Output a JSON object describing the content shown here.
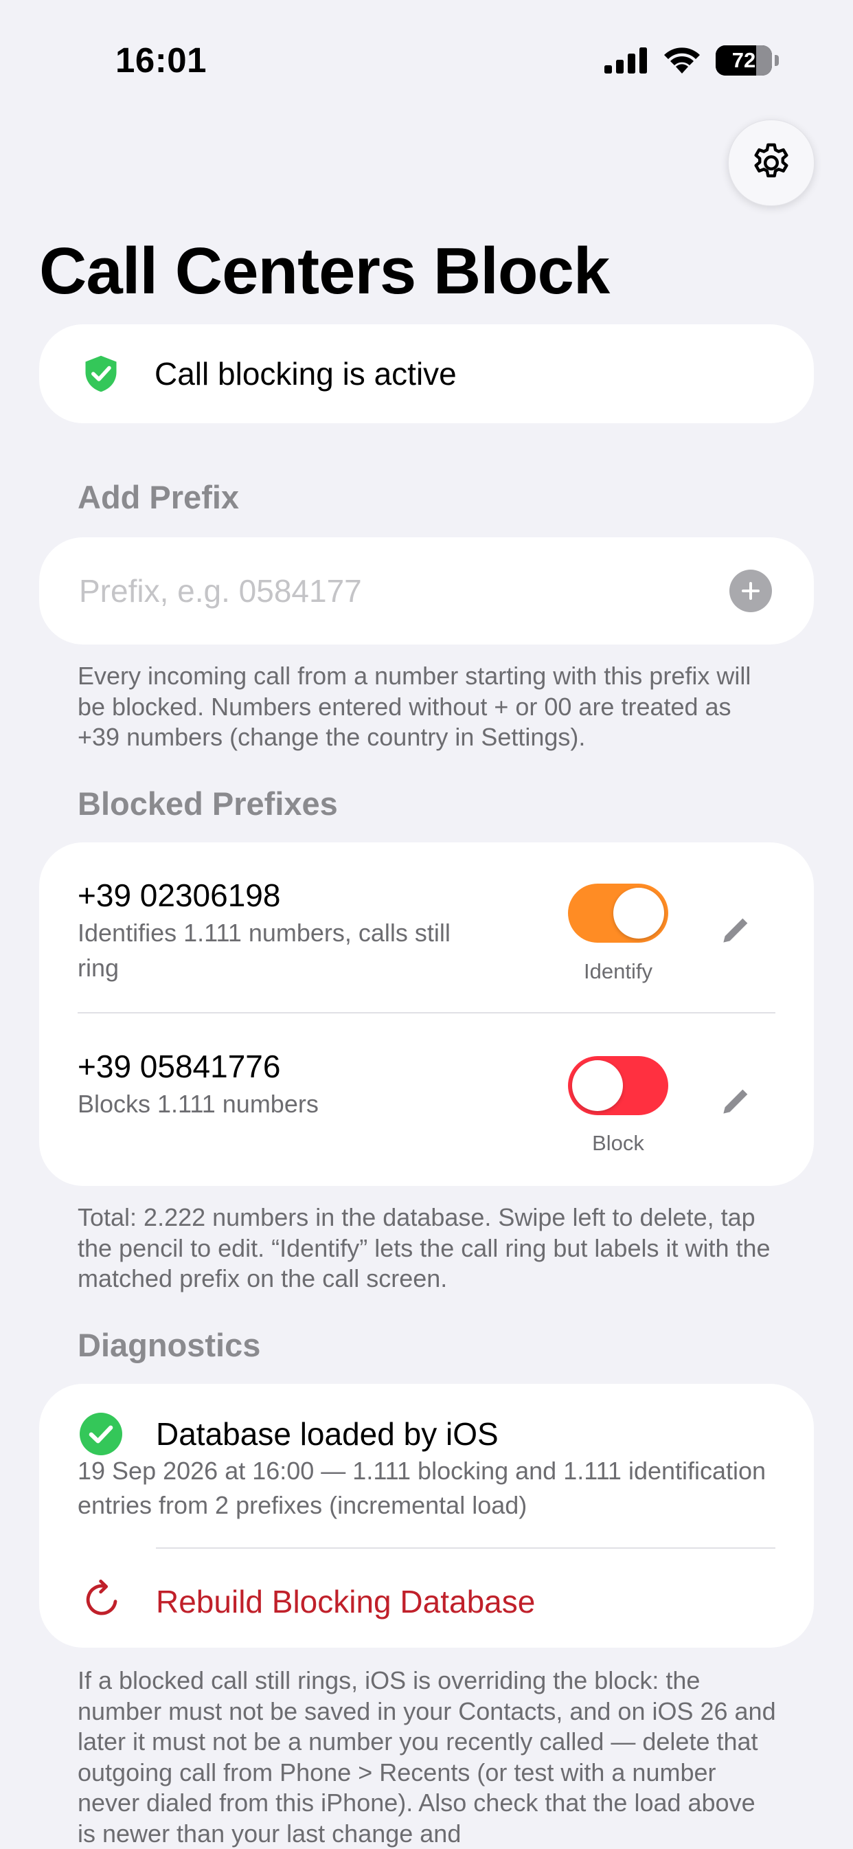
{
  "status_bar": {
    "time": "16:01",
    "battery": "72"
  },
  "header": {
    "title": "Call Centers Block",
    "settings_icon": "gear-icon"
  },
  "status": {
    "text": "Call blocking is active",
    "icon": "shield-check-icon",
    "color": "#34c759"
  },
  "add_prefix": {
    "heading": "Add Prefix",
    "placeholder": "Prefix, e.g. 0584177",
    "value": "",
    "footnote": "Every incoming call from a number starting with this prefix will be blocked. Numbers entered without + or 00 are treated as +39 numbers (change the country in Settings)."
  },
  "blocked_prefixes": {
    "heading": "Blocked Prefixes",
    "items": [
      {
        "number": "+39 02306198",
        "description": "Identifies 1.111 numbers, calls still ring",
        "mode_label": "Identify",
        "toggle_on": true,
        "toggle_color": "#ff8c24"
      },
      {
        "number": "+39 05841776",
        "description": "Blocks 1.111 numbers",
        "mode_label": "Block",
        "toggle_on": false,
        "toggle_color": "#ff3040"
      }
    ],
    "footnote": "Total: 2.222 numbers in the database. Swipe left to delete, tap the pencil to edit. “Identify” lets the call ring but labels it with the matched prefix on the call screen."
  },
  "diagnostics": {
    "heading": "Diagnostics",
    "status_title": "Database loaded by iOS",
    "status_detail": "19 Sep 2026 at 16:00 — 1.111 blocking and 1.111 identification entries from 2 prefixes (incremental load)",
    "rebuild_label": "Rebuild Blocking Database",
    "rebuild_color": "#c0202a",
    "footnote": "If a blocked call still rings, iOS is overriding the block: the number must not be saved in your Contacts, and on iOS 26 and later it must not be a number you recently called — delete that outgoing call from Phone > Recents (or test with a number never dialed from this iPhone). Also check that the load above is newer than your last change and"
  }
}
